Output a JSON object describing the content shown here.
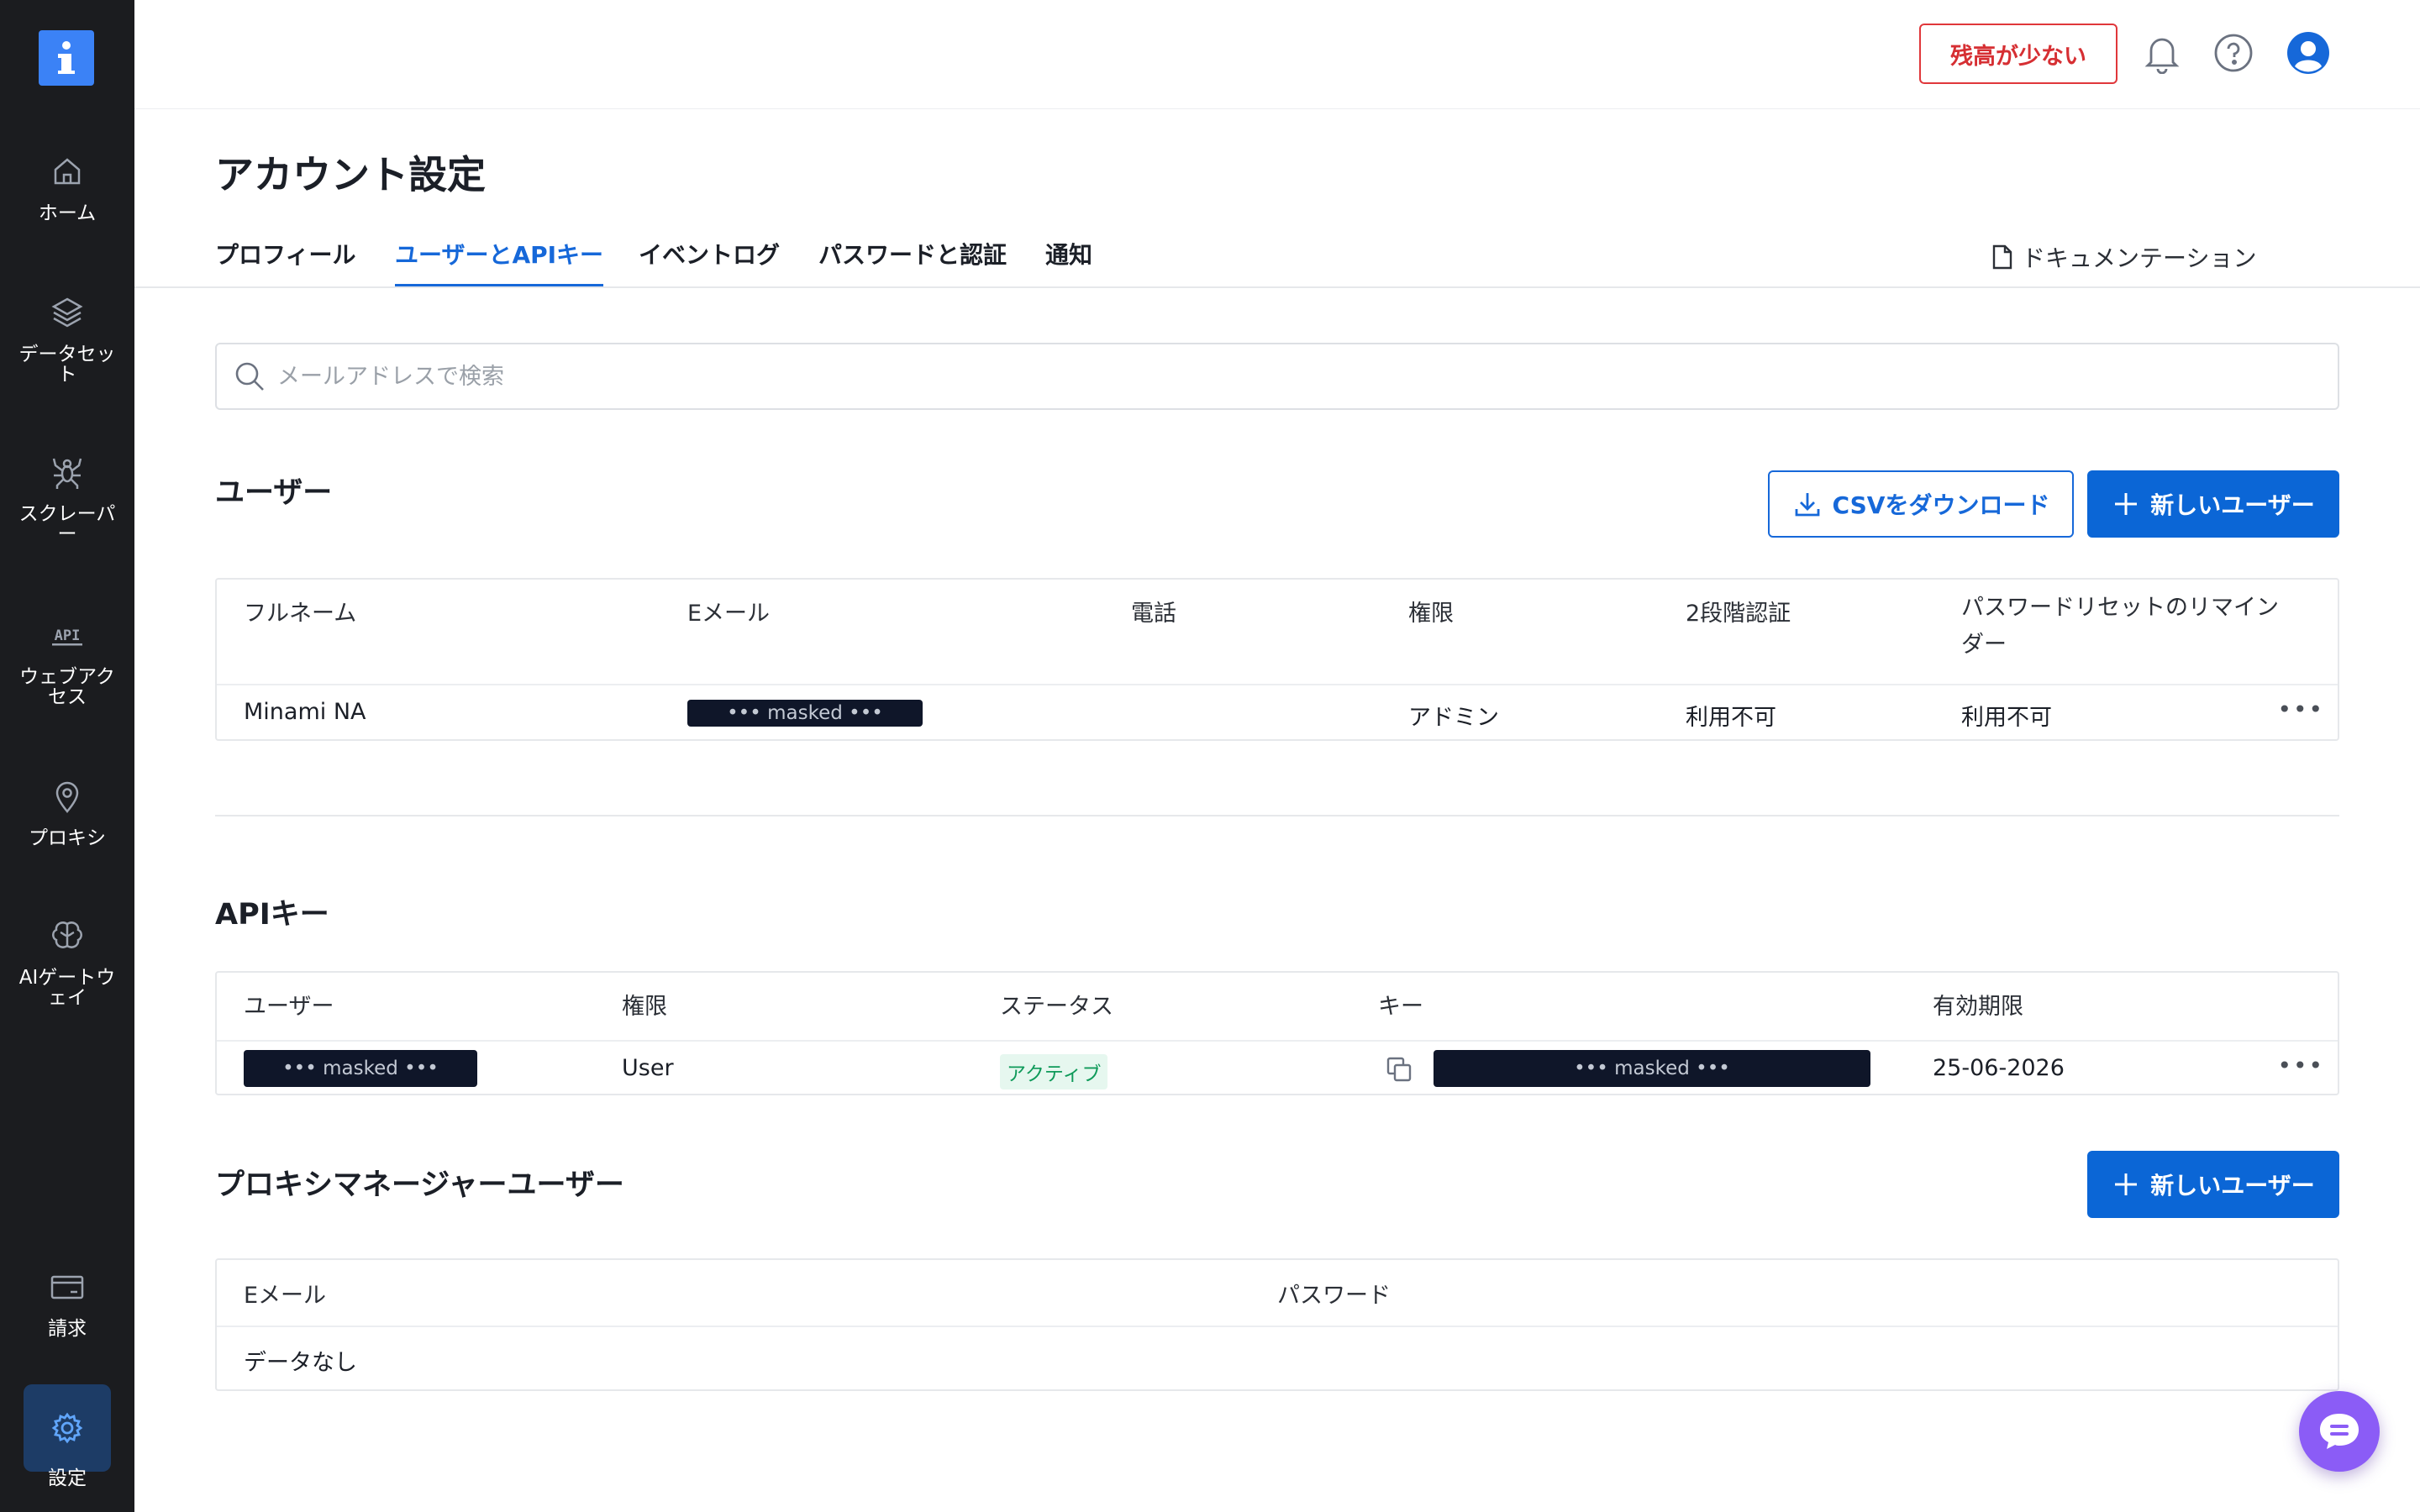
{
  "sidebar": {
    "logo_icon": "info-logo-icon",
    "items": [
      {
        "label": "ホーム",
        "icon": "home-icon"
      },
      {
        "label": "データセット",
        "icon": "layers-icon"
      },
      {
        "label": "スクレーパー",
        "icon": "spider-icon"
      },
      {
        "label": "ウェブアクセス",
        "icon": "api-icon"
      },
      {
        "label": "プロキシ",
        "icon": "location-pin-icon"
      },
      {
        "label": "AIゲートウェイ",
        "icon": "brain-icon"
      },
      {
        "label": "請求",
        "icon": "credit-card-icon"
      },
      {
        "label": "設定",
        "icon": "gear-icon",
        "active": true
      }
    ]
  },
  "header": {
    "low_balance_label": "残高が少ない",
    "icons": [
      "bell-icon",
      "help-icon",
      "user-avatar-icon"
    ]
  },
  "page": {
    "title": "アカウント設定",
    "tabs": [
      {
        "label": "プロフィール",
        "active": false
      },
      {
        "label": "ユーザーとAPIキー",
        "active": true
      },
      {
        "label": "イベントログ",
        "active": false
      },
      {
        "label": "パスワードと認証",
        "active": false
      },
      {
        "label": "通知",
        "active": false
      }
    ],
    "docs_link": "ドキュメンテーション"
  },
  "search": {
    "placeholder": "メールアドレスで検索",
    "value": ""
  },
  "users_section": {
    "title": "ユーザー",
    "csv_button": "CSVをダウンロード",
    "new_user_button": "新しいユーザー",
    "columns": [
      "フルネーム",
      "Eメール",
      "電話",
      "権限",
      "2段階認証",
      "パスワードリセットのリマインダー"
    ],
    "rows": [
      {
        "full_name": "Minami NA",
        "email": "••• masked •••",
        "phone": "",
        "role": "アドミン",
        "two_factor": "利用不可",
        "reset_reminder": "利用不可",
        "more": "•••"
      }
    ]
  },
  "api_keys_section": {
    "title": "APIキー",
    "columns": [
      "ユーザー",
      "権限",
      "ステータス",
      "キー",
      "有効期限"
    ],
    "rows": [
      {
        "user": "••• masked •••",
        "role": "User",
        "status": "アクティブ",
        "key": "••• masked •••",
        "expires": "25-06-2026",
        "more": "•••"
      }
    ]
  },
  "proxy_section": {
    "title": "プロキシマネージャーユーザー",
    "new_user_button": "新しいユーザー",
    "columns": [
      "Eメール",
      "パスワード"
    ],
    "empty_text": "データなし"
  },
  "colors": {
    "sidebar_bg": "#1b1c1f",
    "accent": "#0b66d6",
    "danger": "#e0373b",
    "active_badge_bg": "#e6f7ef",
    "active_badge_text": "#0f9a5a",
    "chat_fab": "#8b5cf6"
  }
}
